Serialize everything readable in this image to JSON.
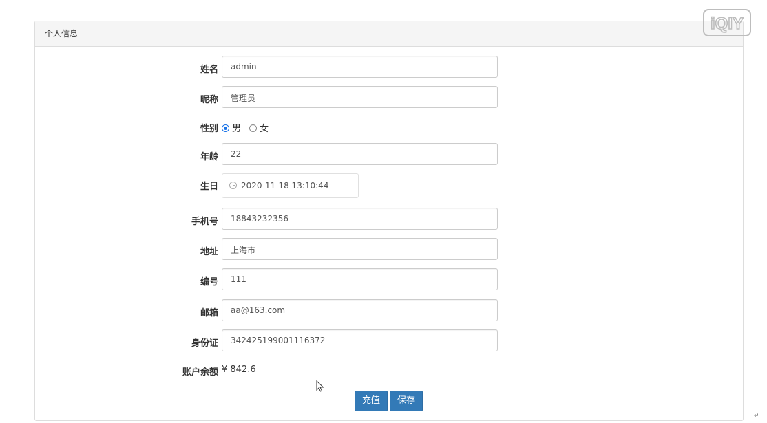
{
  "panel": {
    "title": "个人信息"
  },
  "form": {
    "name": {
      "label": "姓名",
      "value": "admin"
    },
    "nickname": {
      "label": "昵称",
      "value": "管理员"
    },
    "gender": {
      "label": "性别",
      "options": [
        "男",
        "女"
      ],
      "selected": "男"
    },
    "age": {
      "label": "年龄",
      "value": "22"
    },
    "birthday": {
      "label": "生日",
      "value": "2020-11-18 13:10:44"
    },
    "phone": {
      "label": "手机号",
      "value": "18843232356"
    },
    "address": {
      "label": "地址",
      "value": "上海市"
    },
    "number": {
      "label": "编号",
      "value": "111"
    },
    "email": {
      "label": "邮箱",
      "value": "aa@163.com"
    },
    "id_card": {
      "label": "身份证",
      "value": "342425199001116372"
    },
    "balance": {
      "label": "账户余额",
      "value": "¥ 842.6"
    }
  },
  "buttons": {
    "recharge": "充值",
    "save": "保存"
  },
  "watermark": {
    "text": "iQIY",
    "icon": "iqiyi-logo-icon"
  },
  "misc": {
    "return_mark": "↵"
  },
  "colors": {
    "primary": "#337ab7",
    "radio_selected": "#1a73e8",
    "panel_heading_bg": "#f5f5f5"
  }
}
